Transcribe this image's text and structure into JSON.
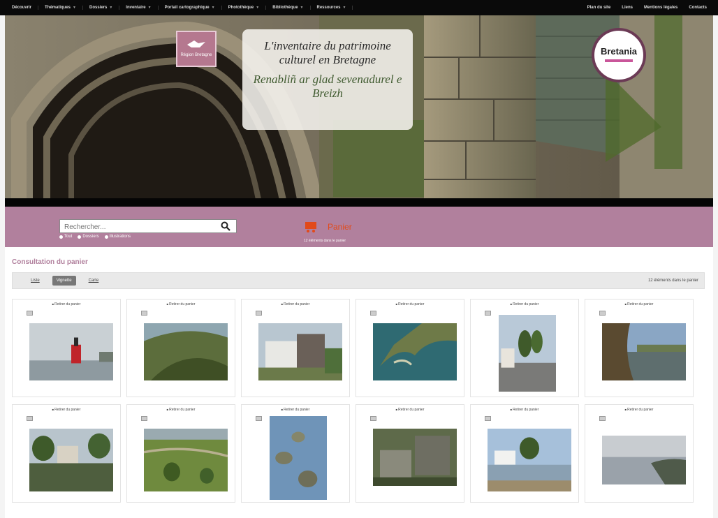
{
  "topnav": {
    "left": [
      {
        "label": "Découvrir",
        "caret": false
      },
      {
        "label": "Thématiques",
        "caret": true
      },
      {
        "label": "Dossiers",
        "caret": true
      },
      {
        "label": "Inventaire",
        "caret": true
      },
      {
        "label": "Portail cartographique",
        "caret": true
      },
      {
        "label": "Photothèque",
        "caret": true
      },
      {
        "label": "Bibliothèque",
        "caret": true
      },
      {
        "label": "Ressources",
        "caret": true
      }
    ],
    "right": [
      "Plan du site",
      "Liens",
      "Mentions légales",
      "Contacts"
    ]
  },
  "banner": {
    "logo_text": "Région Bretagne",
    "tagline_fr": "L'inventaire du patrimoine culturel en Bretagne",
    "tagline_br": "Renabliñ ar glad sevenadurel e Breizh",
    "badge": "Bretania"
  },
  "search": {
    "placeholder": "Rechercher...",
    "options": [
      "Tout",
      "Dossiers",
      "Illustrations"
    ]
  },
  "cart": {
    "label": "Panier",
    "subtitle": "12 éléments dans le panier"
  },
  "page": {
    "title": "Consultation du panier",
    "view_tabs": [
      "Liste",
      "Vignette",
      "Carte"
    ],
    "active_tab": 1,
    "count_text": "12 éléments dans le panier"
  },
  "cards": [
    {
      "remove": "Retirer du panier",
      "scene": "fog-buoy"
    },
    {
      "remove": "Retirer du panier",
      "scene": "green-coast"
    },
    {
      "remove": "Retirer du panier",
      "scene": "modern-building"
    },
    {
      "remove": "Retirer du panier",
      "scene": "aerial-sea"
    },
    {
      "remove": "Retirer du panier",
      "scene": "village-street"
    },
    {
      "remove": "Retirer du panier",
      "scene": "river-shore"
    },
    {
      "remove": "Retirer du panier",
      "scene": "stone-house-pond"
    },
    {
      "remove": "Retirer du panier",
      "scene": "aerial-fields"
    },
    {
      "remove": "Retirer du panier",
      "scene": "tidal-islands"
    },
    {
      "remove": "Retirer du panier",
      "scene": "stone-ruins"
    },
    {
      "remove": "Retirer du panier",
      "scene": "white-house-shore"
    },
    {
      "remove": "Retirer du panier",
      "scene": "misty-estuary"
    }
  ]
}
